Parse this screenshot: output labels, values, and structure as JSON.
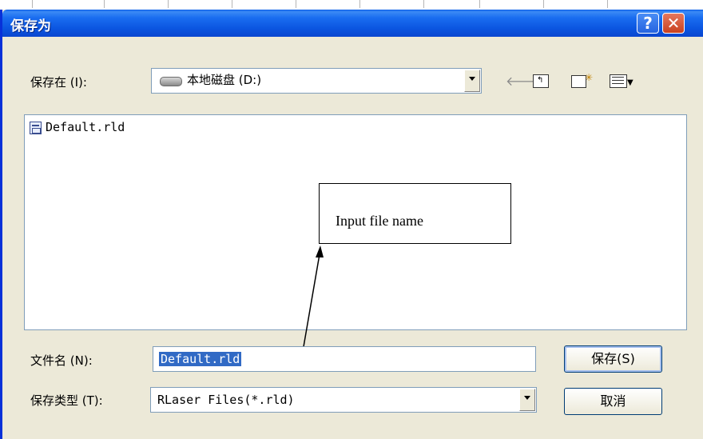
{
  "dialog": {
    "title": "保存为",
    "help_label": "?",
    "close_label": "✕"
  },
  "location": {
    "label": "保存在 (I):",
    "value": "本地磁盘 (D:)",
    "drive_icon": "drive-icon"
  },
  "toolbar": {
    "back_icon": "back-arrow-icon",
    "up_icon": "up-folder-icon",
    "new_folder_icon": "new-folder-icon",
    "view_icon": "view-menu-icon"
  },
  "files": [
    {
      "name": "Default.rld",
      "icon": "rld-file-icon"
    }
  ],
  "annotation": {
    "text": "Input file name"
  },
  "filename": {
    "label": "文件名 (N):",
    "value": "Default.rld"
  },
  "filetype": {
    "label": "保存类型 (T):",
    "value": "RLaser Files(*.rld)"
  },
  "buttons": {
    "save": "保存(S)",
    "cancel": "取消"
  }
}
